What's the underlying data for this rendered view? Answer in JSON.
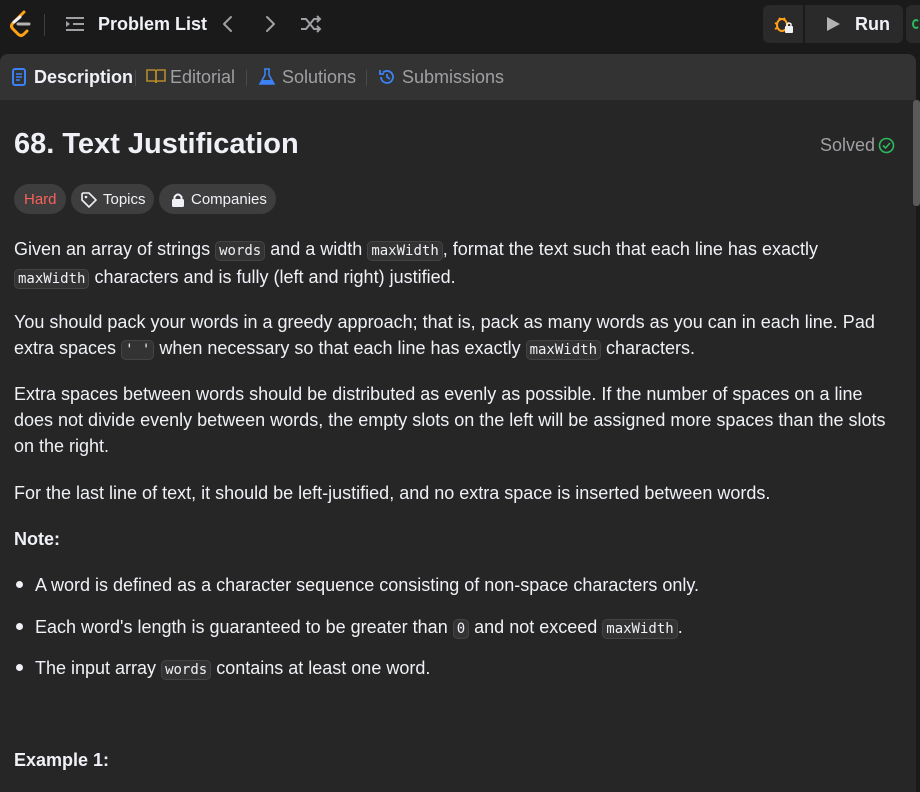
{
  "topbar": {
    "problem_list_label": "Problem List",
    "run_label": "Run"
  },
  "tabs": [
    {
      "label": "Description",
      "icon": "description-icon",
      "color": "#3b82f6"
    },
    {
      "label": "Editorial",
      "icon": "book-icon",
      "color": "#b58a2a"
    },
    {
      "label": "Solutions",
      "icon": "flask-icon",
      "color": "#3b82f6"
    },
    {
      "label": "Submissions",
      "icon": "history-icon",
      "color": "#3b82f6"
    }
  ],
  "problem": {
    "title": "68. Text Justification",
    "status": "Solved",
    "difficulty": "Hard",
    "topics_label": "Topics",
    "companies_label": "Companies"
  },
  "description": {
    "p1": {
      "t1": "Given an array of strings ",
      "c1": "words",
      "t2": " and a width ",
      "c2": "maxWidth",
      "t3": ", format the text such that each line has exactly ",
      "c3": "maxWidth",
      "t4": " characters and is fully (left and right) justified."
    },
    "p2": {
      "t1": "You should pack your words in a greedy approach; that is, pack as many words as you can in each line. Pad extra spaces ",
      "c1": "' '",
      "t2": " when necessary so that each line has exactly ",
      "c2": "maxWidth",
      "t3": " characters."
    },
    "p3": "Extra spaces between words should be distributed as evenly as possible. If the number of spaces on a line does not divide evenly between words, the empty slots on the left will be assigned more spaces than the slots on the right.",
    "p4": "For the last line of text, it should be left-justified, and no extra space is inserted between words.",
    "note_heading": "Note:",
    "bullets": {
      "b1": "A word is defined as a character sequence consisting of non-space characters only.",
      "b2": {
        "t1": "Each word's length is guaranteed to be greater than ",
        "c1": "0",
        "t2": " and not exceed ",
        "c2": "maxWidth",
        "t3": "."
      },
      "b3": {
        "t1": "The input array ",
        "c1": "words",
        "t2": " contains at least one word."
      }
    },
    "example_heading": "Example 1:"
  },
  "colors": {
    "accent_blue": "#3b82f6",
    "hard_red": "#f8615c",
    "solved_green": "#2cbb5d",
    "logo_orange": "#ffa116"
  }
}
